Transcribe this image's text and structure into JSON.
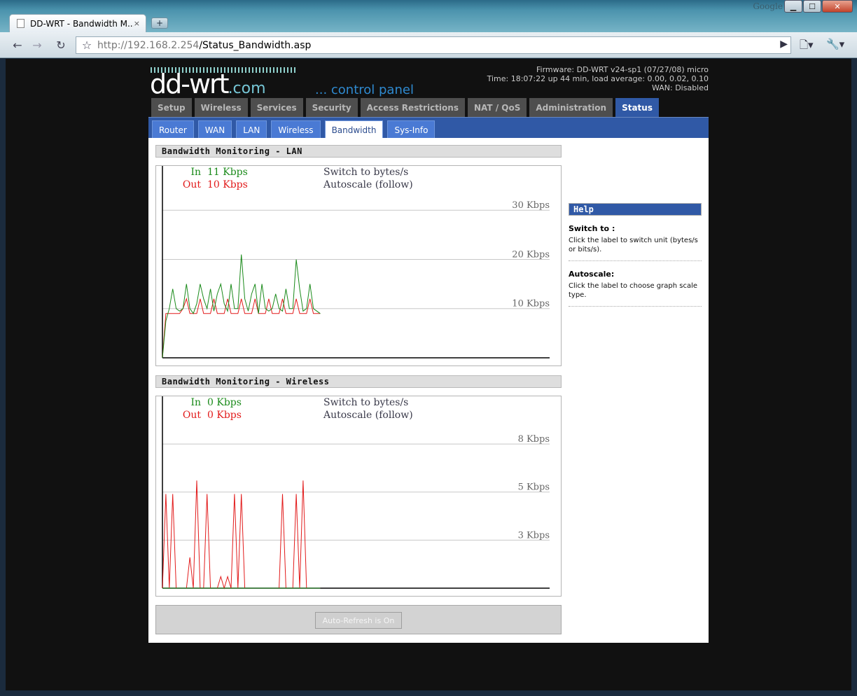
{
  "browser": {
    "google_label": "Google",
    "tab_title": "DD-WRT - Bandwidth M...",
    "tab_close": "×",
    "new_tab": "+",
    "url_host": "http://192.168.2.254",
    "url_path": "/Status_Bandwidth.asp",
    "min": "▁",
    "max": "☐",
    "close": "✕"
  },
  "header": {
    "logo_main": "dd-wrt",
    "logo_com": ".com",
    "control_panel": "... control panel",
    "firmware": "Firmware: DD-WRT v24-sp1 (07/27/08) micro",
    "time": "Time: 18:07:22 up 44 min, load average: 0.00, 0.02, 0.10",
    "wan": "WAN: Disabled"
  },
  "main_nav": [
    "Setup",
    "Wireless",
    "Services",
    "Security",
    "Access Restrictions",
    "NAT / QoS",
    "Administration",
    "Status"
  ],
  "main_nav_active": "Status",
  "sub_nav": [
    "Router",
    "WAN",
    "LAN",
    "Wireless",
    "Bandwidth",
    "Sys-Info"
  ],
  "sub_nav_active": "Bandwidth",
  "lan": {
    "title": "Bandwidth Monitoring - LAN",
    "in_label": "In",
    "in_value": "11 Kbps",
    "out_label": "Out",
    "out_value": "10 Kbps",
    "switch_label": "Switch to bytes/s",
    "autoscale_label": "Autoscale (follow)",
    "grid_labels": [
      "30 Kbps",
      "20 Kbps",
      "10 Kbps"
    ],
    "grid_values": [
      30,
      20,
      10
    ],
    "ymax": 39,
    "in_series": [
      0,
      7.5,
      10,
      14,
      10,
      9.5,
      10,
      15,
      10,
      9,
      11,
      15,
      12,
      10,
      14,
      9.5,
      13,
      15,
      11,
      9.5,
      15,
      10,
      10,
      21,
      12,
      9.5,
      13,
      15,
      9,
      15,
      10,
      9.5,
      10,
      13,
      10,
      9.5,
      14,
      10,
      10,
      20,
      14,
      9.5,
      10,
      15,
      10,
      9.5,
      9
    ],
    "out_series": [
      0,
      9,
      9,
      9,
      9,
      9,
      10,
      12,
      9,
      9,
      9,
      12,
      9,
      9,
      9,
      12,
      9,
      9,
      9,
      12,
      9,
      9,
      9,
      12,
      9,
      9,
      9,
      12,
      9,
      9,
      9,
      12,
      9,
      9,
      9,
      12,
      9,
      9,
      9,
      12,
      9,
      9,
      9,
      12,
      9,
      9,
      9
    ]
  },
  "wireless": {
    "title": "Bandwidth Monitoring - Wireless",
    "in_label": "In",
    "in_value": "0 Kbps",
    "out_label": "Out",
    "out_value": "0 Kbps",
    "switch_label": "Switch to bytes/s",
    "autoscale_label": "Autoscale (follow)",
    "grid_labels": [
      "8 Kbps",
      "5 Kbps",
      "3 Kbps"
    ],
    "grid_values": [
      7.5,
      5,
      2.5
    ],
    "ymax": 9.98,
    "in_series": [
      0,
      0,
      0,
      0,
      0,
      0,
      0,
      0,
      0,
      0,
      0,
      0,
      0,
      0,
      0,
      0,
      0,
      0,
      0,
      0,
      0,
      0,
      0,
      0,
      0,
      0,
      0,
      0,
      0,
      0,
      0,
      0,
      0,
      0,
      0,
      0,
      0,
      0,
      0,
      0,
      0,
      0,
      0,
      0,
      0,
      0,
      0
    ],
    "out_series": [
      0,
      4.9,
      0,
      4.9,
      0,
      0,
      0,
      0,
      1.6,
      0,
      5.6,
      0,
      0,
      4.9,
      0,
      0,
      0,
      0.6,
      0,
      0.6,
      0,
      4.9,
      0,
      4.9,
      0,
      0,
      0,
      0,
      0,
      0,
      0,
      0,
      0,
      0,
      0,
      4.9,
      0,
      0,
      0,
      4.9,
      0,
      5.6,
      0,
      0,
      0,
      0,
      0
    ]
  },
  "refresh_button": "Auto-Refresh is On",
  "help": {
    "title": "Help",
    "items": [
      {
        "term": "Switch to :",
        "desc": "Click the label to switch unit (bytes/s or bits/s)."
      },
      {
        "term": "Autoscale:",
        "desc": "Click the label to choose graph scale type."
      }
    ]
  },
  "colors": {
    "in": "#1a8a1a",
    "out": "#e21b1b",
    "nav_active": "#3059a6",
    "grid": "#c8c8c8"
  }
}
